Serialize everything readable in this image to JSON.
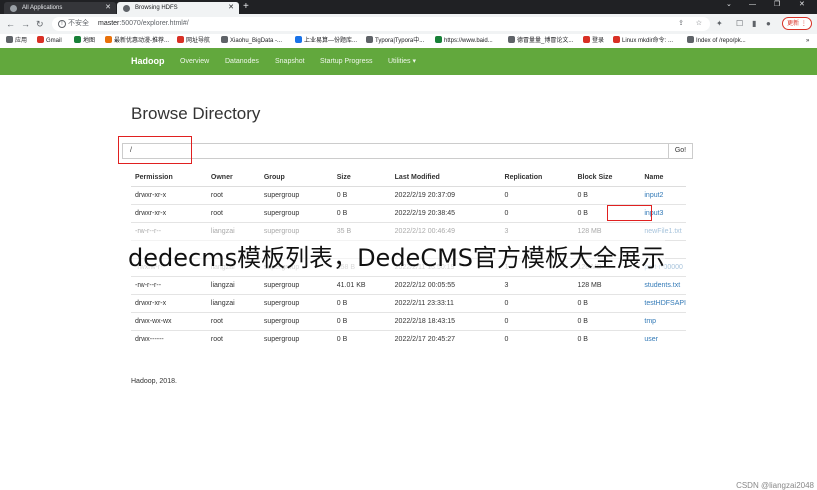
{
  "browser": {
    "tabs": [
      {
        "label": "All Applications",
        "active": false
      },
      {
        "label": "Browsing HDFS",
        "active": true
      }
    ],
    "new_tab": "+",
    "window_controls": [
      "⌄",
      "—",
      "❐",
      "✕"
    ],
    "security_label": "不安全",
    "url_host": "master",
    "url_rest": ":50070/explorer.html#/",
    "update_label": "更新",
    "bookmarks": [
      {
        "label": "应用",
        "color": "#5f6368"
      },
      {
        "label": "Gmail",
        "color": "#d93025"
      },
      {
        "label": "地图",
        "color": "#188038"
      },
      {
        "label": "最新优惠动漫-推荐...",
        "color": "#e8710a"
      },
      {
        "label": "网址导航",
        "color": "#d93025"
      },
      {
        "label": "Xiaohu_BigData -...",
        "color": "#5f6368"
      },
      {
        "label": "上业易算—份题库...",
        "color": "#1a73e8"
      },
      {
        "label": "Typora|Typora中...",
        "color": "#5f6368"
      },
      {
        "label": "https://www.baid...",
        "color": "#188038"
      },
      {
        "label": "德冒量量_博冒论文...",
        "color": "#5f6368"
      },
      {
        "label": "登录",
        "color": "#d93025"
      },
      {
        "label": "Linux mkdir命令: ...",
        "color": "#d93025"
      },
      {
        "label": "Index of /repo/pk...",
        "color": "#5f6368"
      }
    ],
    "bookmarks_more": "»"
  },
  "navbar": {
    "brand": "Hadoop",
    "links": [
      "Overview",
      "Datanodes",
      "Snapshot",
      "Startup Progress",
      "Utilities ▾"
    ],
    "color": "#62a83d"
  },
  "page": {
    "title": "Browse Directory",
    "path_value": "/",
    "go_label": "Go!"
  },
  "table": {
    "headers": [
      "Permission",
      "Owner",
      "Group",
      "Size",
      "Last Modified",
      "Replication",
      "Block Size",
      "Name"
    ],
    "rows": [
      [
        "drwxr-xr-x",
        "root",
        "supergroup",
        "0 B",
        "2022/2/19 20:37:09",
        "0",
        "0 B",
        "input2"
      ],
      [
        "drwxr-xr-x",
        "root",
        "supergroup",
        "0 B",
        "2022/2/19 20:38:45",
        "0",
        "0 B",
        "input3"
      ],
      [
        "-rw-r--r--",
        "liangzai",
        "supergroup",
        "35 B",
        "2022/2/12 00:46:49",
        "3",
        "128 MB",
        "newFile1.txt"
      ],
      [
        "",
        "",
        "",
        "",
        "",
        "",
        "",
        ""
      ],
      [
        "-rwxrw-r--",
        "liangzai",
        "supergroup",
        "158 B",
        "2022/2/11 13:50:19",
        "1",
        "128 MB",
        "part-r-00000"
      ],
      [
        "-rw-r--r--",
        "liangzai",
        "supergroup",
        "41.01 KB",
        "2022/2/12 00:05:55",
        "3",
        "128 MB",
        "students.txt"
      ],
      [
        "drwxr-xr-x",
        "liangzai",
        "supergroup",
        "0 B",
        "2022/2/11 23:33:11",
        "0",
        "0 B",
        "testHDFSAPI"
      ],
      [
        "drwx-wx-wx",
        "root",
        "supergroup",
        "0 B",
        "2022/2/18 18:43:15",
        "0",
        "0 B",
        "tmp"
      ],
      [
        "drwx------",
        "root",
        "supergroup",
        "0 B",
        "2022/2/17 20:45:27",
        "0",
        "0 B",
        "user"
      ]
    ]
  },
  "footer": "Hadoop, 2018.",
  "overlay_text": "dedecms模板列表，DedeCMS官方模板大全展示",
  "watermark": "CSDN @liangzai2048"
}
